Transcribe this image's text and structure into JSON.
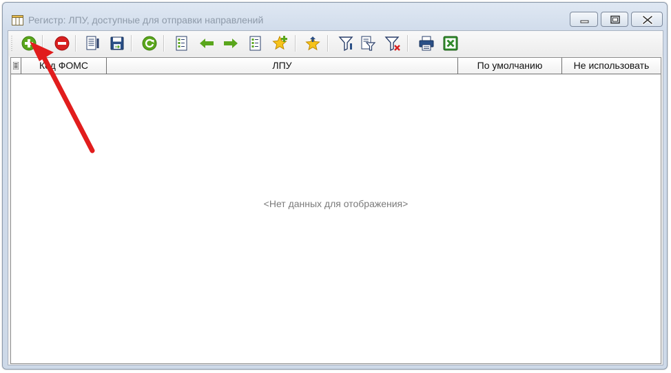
{
  "window": {
    "title": "Регистр: ЛПУ, доступные для отправки направлений",
    "icon": "table-icon",
    "controls": [
      "minimize-icon",
      "maximize-icon",
      "close-icon"
    ]
  },
  "toolbar": {
    "buttons": [
      {
        "name": "add",
        "icon": "plus-circle-icon"
      },
      {
        "name": "delete",
        "icon": "minus-circle-icon"
      },
      {
        "name": "edit",
        "icon": "edit-document-icon"
      },
      {
        "name": "save",
        "icon": "save-icon"
      },
      {
        "name": "refresh",
        "icon": "refresh-icon"
      },
      {
        "name": "details",
        "icon": "list-document-icon"
      },
      {
        "name": "previous",
        "icon": "arrow-left-icon"
      },
      {
        "name": "next",
        "icon": "arrow-right-icon"
      },
      {
        "name": "details-2",
        "icon": "list-document-icon"
      },
      {
        "name": "add-favorite",
        "icon": "star-plus-icon"
      },
      {
        "name": "favorites",
        "icon": "star-arrow-icon"
      },
      {
        "name": "filter",
        "icon": "filter-icon"
      },
      {
        "name": "filter-edit",
        "icon": "filter-edit-icon"
      },
      {
        "name": "filter-clear",
        "icon": "filter-clear-icon"
      },
      {
        "name": "print",
        "icon": "printer-icon"
      },
      {
        "name": "export-excel",
        "icon": "excel-icon"
      }
    ]
  },
  "grid": {
    "columns": [
      "Код ФОМС",
      "ЛПУ",
      "По умолчанию",
      "Не использовать"
    ],
    "rows": [],
    "empty_text": "<Нет данных для отображения>"
  },
  "colors": {
    "accent_green": "#5aa61c",
    "delete_red": "#d81f1f",
    "annotation_arrow": "#e11d1d"
  }
}
